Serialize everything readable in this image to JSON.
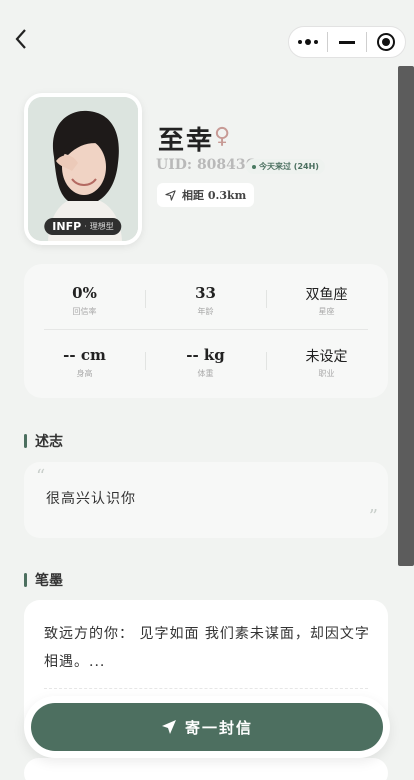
{
  "nav": {
    "back_icon": "chevron-left-icon",
    "capsule": [
      "more-icon",
      "minimize-icon",
      "close-target-icon"
    ]
  },
  "profile": {
    "name": "至幸",
    "gender_symbol": "♀",
    "uid": "UID: 808436",
    "online": "今天来过 (24H)",
    "distance": "相距 0.3km",
    "mbti_code": "INFP",
    "mbti_sep": "·",
    "mbti_type": "理想型"
  },
  "stats": [
    {
      "value": "0%",
      "label": "回信率"
    },
    {
      "value": "33",
      "label": "年龄"
    },
    {
      "value": "双鱼座",
      "label": "星座"
    },
    {
      "value": "-- cm",
      "label": "身高"
    },
    {
      "value": "-- kg",
      "label": "体重"
    },
    {
      "value": "未设定",
      "label": "职业"
    }
  ],
  "sections": {
    "intro_title": "述志",
    "intro_text": "很高兴认识你",
    "letters_title": "笔墨",
    "letter_preview": "致远方的你： 见字如面 我们素未谋面，却因文字相遇。..."
  },
  "actions": {
    "send_label": "寄一封信"
  },
  "colors": {
    "accent": "#4d6f60",
    "background": "#f1f3f1",
    "gender": "#c79a95"
  }
}
